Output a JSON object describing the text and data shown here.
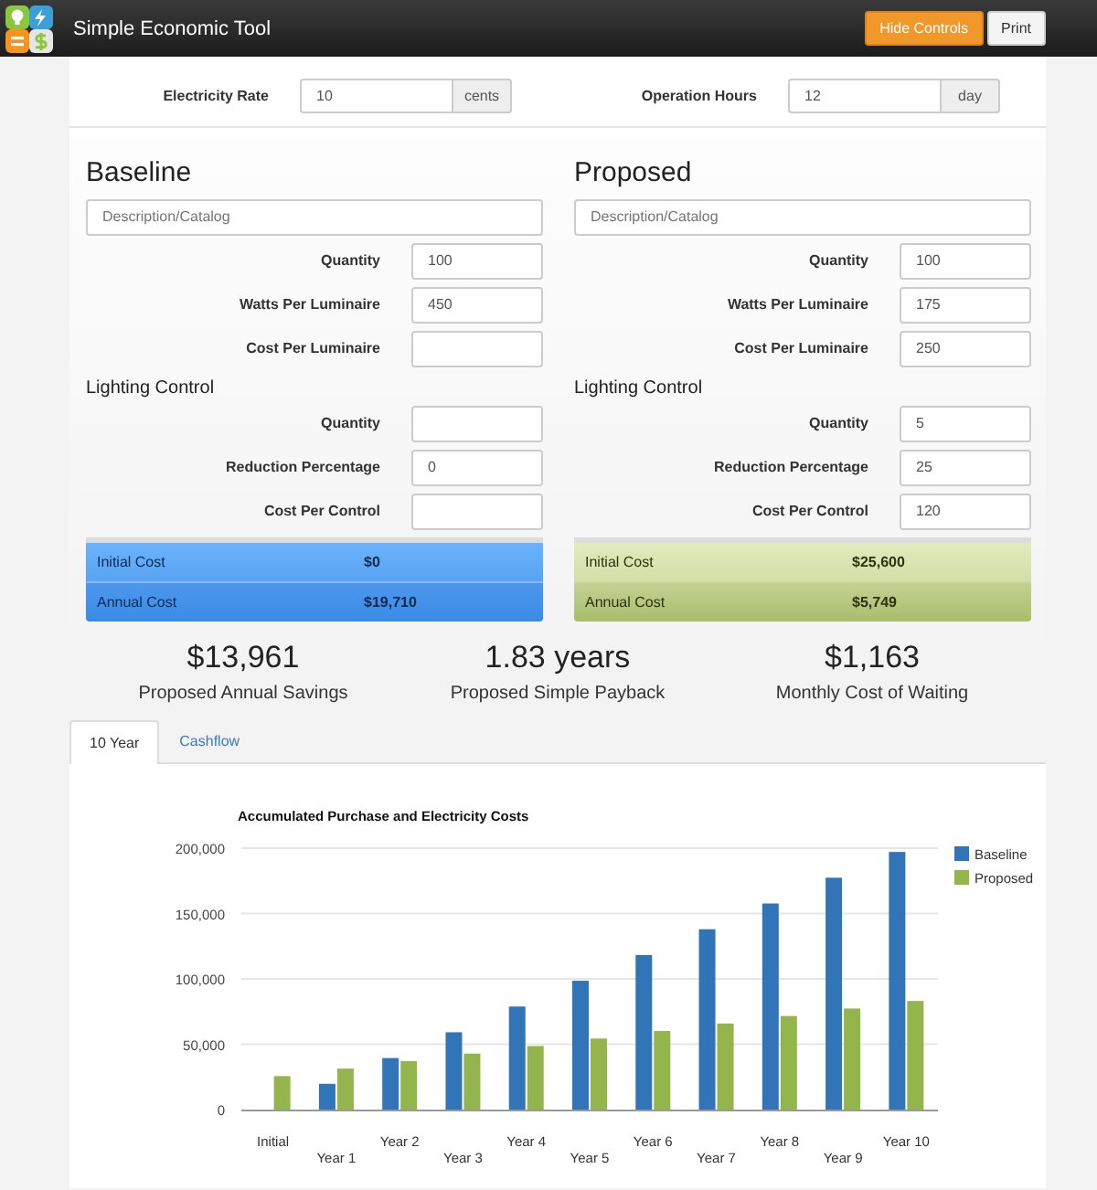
{
  "header": {
    "title": "Simple Economic Tool",
    "buttons": [
      {
        "label": "Hide Controls",
        "kind": "primary"
      },
      {
        "label": "Print",
        "kind": "default"
      }
    ]
  },
  "rates": [
    {
      "label": "Electricity Rate",
      "value": "10",
      "unit": "cents"
    },
    {
      "label": "Operation Hours",
      "value": "12",
      "unit": "day"
    }
  ],
  "systems": [
    {
      "kind": "baseline",
      "title": "Baseline",
      "description": {
        "placeholder": "Description/Catalog"
      },
      "fields": [
        {
          "label": "Quantity",
          "value": "100"
        },
        {
          "label": "Watts Per Luminaire",
          "value": "450"
        },
        {
          "label": "Cost Per Luminaire"
        }
      ],
      "control_title": "Lighting Control",
      "control_fields": [
        {
          "label": "Quantity"
        },
        {
          "label": "Reduction Percentage",
          "value": "0"
        },
        {
          "label": "Cost Per Control"
        }
      ],
      "costs": [
        {
          "label": "Initial Cost",
          "value": "$0"
        },
        {
          "label": "Annual Cost",
          "value": "$19,710"
        }
      ]
    },
    {
      "kind": "proposed",
      "title": "Proposed",
      "description": {
        "placeholder": "Description/Catalog"
      },
      "fields": [
        {
          "label": "Quantity",
          "value": "100"
        },
        {
          "label": "Watts Per Luminaire",
          "value": "175"
        },
        {
          "label": "Cost Per Luminaire",
          "value": "250"
        }
      ],
      "control_title": "Lighting Control",
      "control_fields": [
        {
          "label": "Quantity",
          "value": "5"
        },
        {
          "label": "Reduction Percentage",
          "value": "25"
        },
        {
          "label": "Cost Per Control",
          "value": "120"
        }
      ],
      "costs": [
        {
          "label": "Initial Cost",
          "value": "$25,600"
        },
        {
          "label": "Annual Cost",
          "value": "$5,749"
        }
      ]
    }
  ],
  "stats": [
    {
      "value": "$13,961",
      "caption": "Proposed Annual Savings"
    },
    {
      "value": "1.83 years",
      "caption": "Proposed Simple Payback"
    },
    {
      "value": "$1,163",
      "caption": "Monthly Cost of Waiting"
    }
  ],
  "tabs": [
    {
      "label": "10 Year",
      "selected": true
    },
    {
      "label": "Cashflow",
      "selected": false
    }
  ],
  "chart_data": {
    "type": "bar",
    "title": "Accumulated Purchase and Electricity Costs",
    "categories": [
      "Initial",
      "Year 1",
      "Year 2",
      "Year 3",
      "Year 4",
      "Year 5",
      "Year 6",
      "Year 7",
      "Year 8",
      "Year 9",
      "Year 10"
    ],
    "series": [
      {
        "name": "Baseline",
        "color": "#3274b8",
        "values": [
          0,
          19710,
          39420,
          59130,
          78840,
          98550,
          118260,
          137970,
          157680,
          177390,
          197100
        ]
      },
      {
        "name": "Proposed",
        "color": "#94b44c",
        "values": [
          25600,
          31349,
          37098,
          42847,
          48596,
          54345,
          60094,
          65843,
          71592,
          77341,
          83090
        ]
      }
    ],
    "grid": true,
    "legend": true,
    "ylim": [
      0,
      200000
    ],
    "yticks": [
      {
        "value": 0,
        "label": "0"
      },
      {
        "value": 50000,
        "label": "50,000"
      },
      {
        "value": 100000,
        "label": "100,000"
      },
      {
        "value": 150000,
        "label": "150,000"
      },
      {
        "value": 200000,
        "label": "200,000"
      }
    ]
  }
}
